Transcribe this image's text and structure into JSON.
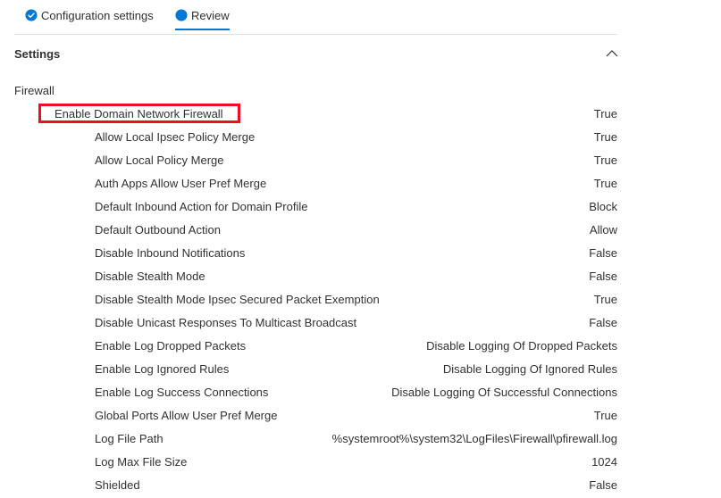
{
  "tabs": [
    {
      "label": "Configuration settings",
      "icon": "check-circle-icon",
      "active": false
    },
    {
      "label": "Review",
      "icon": "filled-circle-icon",
      "active": true
    }
  ],
  "section": {
    "title": "Settings",
    "icon": "chevron-up-icon"
  },
  "group": {
    "title": "Firewall"
  },
  "rows": [
    {
      "label": "Enable Domain Network Firewall",
      "value": "True"
    },
    {
      "label": "Allow Local Ipsec Policy Merge",
      "value": "True"
    },
    {
      "label": "Allow Local Policy Merge",
      "value": "True"
    },
    {
      "label": "Auth Apps Allow User Pref Merge",
      "value": "True"
    },
    {
      "label": "Default Inbound Action for Domain Profile",
      "value": "Block"
    },
    {
      "label": "Default Outbound Action",
      "value": "Allow"
    },
    {
      "label": "Disable Inbound Notifications",
      "value": "False"
    },
    {
      "label": "Disable Stealth Mode",
      "value": "False"
    },
    {
      "label": "Disable Stealth Mode Ipsec Secured Packet Exemption",
      "value": "True"
    },
    {
      "label": "Disable Unicast Responses To Multicast Broadcast",
      "value": "False"
    },
    {
      "label": "Enable Log Dropped Packets",
      "value": "Disable Logging Of Dropped Packets"
    },
    {
      "label": "Enable Log Ignored Rules",
      "value": "Disable Logging Of Ignored Rules"
    },
    {
      "label": "Enable Log Success Connections",
      "value": "Disable Logging Of Successful Connections"
    },
    {
      "label": "Global Ports Allow User Pref Merge",
      "value": "True"
    },
    {
      "label": "Log File Path",
      "value": "%systemroot%\\system32\\LogFiles\\Firewall\\pfirewall.log"
    },
    {
      "label": "Log Max File Size",
      "value": "1024"
    },
    {
      "label": "Shielded",
      "value": "False"
    }
  ],
  "colors": {
    "accent": "#0078d4",
    "highlight": "#e81123",
    "text": "#323130",
    "divider": "#e1dfdd"
  }
}
